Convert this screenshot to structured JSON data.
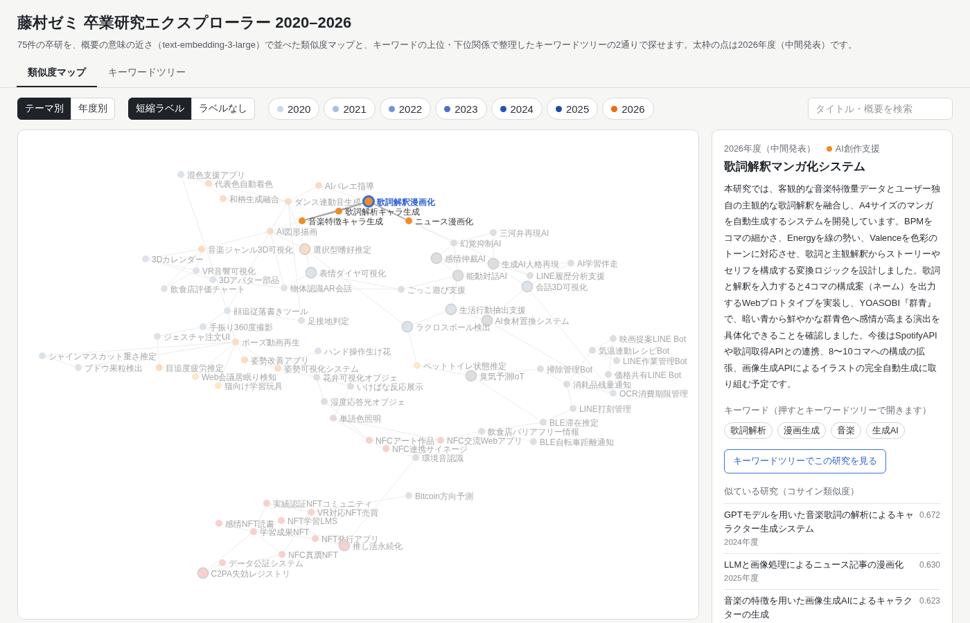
{
  "header": {
    "title": "藤村ゼミ 卒業研究エクスプローラー 2020–2026",
    "description": "75件の卒研を、概要の意味の近さ（text-embedding-3-large）で並べた類似度マップと、キーワードの上位・下位関係で整理したキーワードツリーの2通りで探せます。太枠の点は2026年度（中間発表）です。"
  },
  "tabs": [
    {
      "label": "類似度マップ",
      "selected": true
    },
    {
      "label": "キーワードツリー",
      "selected": false
    }
  ],
  "toolbar": {
    "grouping": [
      {
        "label": "テーマ別",
        "selected": true
      },
      {
        "label": "年度別",
        "selected": false
      }
    ],
    "labels": [
      {
        "label": "短縮ラベル",
        "selected": true
      },
      {
        "label": "ラベルなし",
        "selected": false
      }
    ],
    "years": [
      {
        "label": "2020",
        "color": "#cdd8ee"
      },
      {
        "label": "2021",
        "color": "#a8bce5"
      },
      {
        "label": "2022",
        "color": "#7492dd"
      },
      {
        "label": "2023",
        "color": "#4d6fc6"
      },
      {
        "label": "2024",
        "color": "#2156b2"
      },
      {
        "label": "2025",
        "color": "#1b4c9e"
      },
      {
        "label": "2026",
        "color": "#ec6a12"
      }
    ],
    "search": {
      "placeholder": "タイトル・概要を検索"
    }
  },
  "map": {
    "nodes": [
      {
        "label": "混色支援アプリ",
        "color": "#dde3ea",
        "highlighted": false,
        "selected": false,
        "midterm": false
      },
      {
        "label": "代表色自動着色",
        "color": "#fbdcc2",
        "highlighted": false,
        "selected": false,
        "midterm": false
      },
      {
        "label": "AIバレエ指導",
        "color": "#fbdcc2",
        "highlighted": false,
        "selected": false,
        "midterm": false
      },
      {
        "label": "和柄生成融合",
        "color": "#fbdcc2",
        "highlighted": false,
        "selected": false,
        "midterm": false
      },
      {
        "label": "ダンス連動音生成",
        "color": "#fbdcc2",
        "highlighted": false,
        "selected": false,
        "midterm": false
      },
      {
        "label": "歌詞解釈漫画化",
        "color": "#f28a25",
        "highlighted": true,
        "selected": true,
        "midterm": true
      },
      {
        "label": "歌詞解析キャラ生成",
        "color": "#f28a25",
        "highlighted": true,
        "selected": false,
        "midterm": false
      },
      {
        "label": "音楽特徴キャラ生成",
        "color": "#f28a25",
        "highlighted": true,
        "selected": false,
        "midterm": false
      },
      {
        "label": "ニュース漫画化",
        "color": "#f28a25",
        "highlighted": true,
        "selected": false,
        "midterm": false
      },
      {
        "label": "AI図形描画",
        "color": "#fbdcc2",
        "highlighted": false,
        "selected": false,
        "midterm": false
      },
      {
        "label": "三河弁再現AI",
        "color": "#dedede",
        "highlighted": false,
        "selected": false,
        "midterm": false
      },
      {
        "label": "幻覚抑制AI",
        "color": "#dedede",
        "highlighted": false,
        "selected": false,
        "midterm": false
      },
      {
        "label": "音楽ジャンル3D可視化",
        "color": "#fbdcc2",
        "highlighted": false,
        "selected": false,
        "midterm": false
      },
      {
        "label": "選択型嗜好推定",
        "color": "#fbdcc2",
        "highlighted": false,
        "selected": false,
        "midterm": true
      },
      {
        "label": "3Dカレンダー",
        "color": "#dde3ea",
        "highlighted": false,
        "selected": false,
        "midterm": false
      },
      {
        "label": "感情仲裁AI",
        "color": "#dedede",
        "highlighted": false,
        "selected": false,
        "midterm": true
      },
      {
        "label": "生成AI人格再現",
        "color": "#dedede",
        "highlighted": false,
        "selected": false,
        "midterm": true
      },
      {
        "label": "AI学習伴走",
        "color": "#dedede",
        "highlighted": false,
        "selected": false,
        "midterm": false
      },
      {
        "label": "VR音響可視化",
        "color": "#dde3ea",
        "highlighted": false,
        "selected": false,
        "midterm": false
      },
      {
        "label": "表情ダイヤ可視化",
        "color": "#dde3ea",
        "highlighted": false,
        "selected": false,
        "midterm": true
      },
      {
        "label": "能動対話AI",
        "color": "#dedede",
        "highlighted": false,
        "selected": false,
        "midterm": true
      },
      {
        "label": "LINE履歴分析支援",
        "color": "#dedede",
        "highlighted": false,
        "selected": false,
        "midterm": false
      },
      {
        "label": "3Dアバター部品",
        "color": "#dde3ea",
        "highlighted": false,
        "selected": false,
        "midterm": false
      },
      {
        "label": "飲食店評価チャート",
        "color": "#dde3ea",
        "highlighted": false,
        "selected": false,
        "midterm": false
      },
      {
        "label": "物体認識AR会話",
        "color": "#dde3ea",
        "highlighted": false,
        "selected": false,
        "midterm": false
      },
      {
        "label": "ごっこ遊び支援",
        "color": "#dedede",
        "highlighted": false,
        "selected": false,
        "midterm": false
      },
      {
        "label": "会話3D可視化",
        "color": "#dde3ea",
        "highlighted": false,
        "selected": false,
        "midterm": true
      },
      {
        "label": "顔追従落書きツール",
        "color": "#dde3ea",
        "highlighted": false,
        "selected": false,
        "midterm": false
      },
      {
        "label": "生活行動抽出支援",
        "color": "#dde3ea",
        "highlighted": false,
        "selected": false,
        "midterm": true
      },
      {
        "label": "足接地判定",
        "color": "#dde3ea",
        "highlighted": false,
        "selected": false,
        "midterm": false
      },
      {
        "label": "AI食材置換システム",
        "color": "#dedede",
        "highlighted": false,
        "selected": false,
        "midterm": true
      },
      {
        "label": "手振り360度撮影",
        "color": "#dde3ea",
        "highlighted": false,
        "selected": false,
        "midterm": false
      },
      {
        "label": "ラクロスボール検出",
        "color": "#dde3ea",
        "highlighted": false,
        "selected": false,
        "midterm": true
      },
      {
        "label": "ジェスチャ注文UI",
        "color": "#dde3ea",
        "highlighted": false,
        "selected": false,
        "midterm": false
      },
      {
        "label": "ポーズ動画再生",
        "color": "#fbdcc2",
        "highlighted": false,
        "selected": false,
        "midterm": false
      },
      {
        "label": "映画提案LINE Bot",
        "color": "#dedede",
        "highlighted": false,
        "selected": false,
        "midterm": false
      },
      {
        "label": "シャインマスカット重さ推定",
        "color": "#dde3ea",
        "highlighted": false,
        "selected": false,
        "midterm": false
      },
      {
        "label": "ハンド操作生け花",
        "color": "#dde3ea",
        "highlighted": false,
        "selected": false,
        "midterm": false
      },
      {
        "label": "気温連動レシピBot",
        "color": "#dedede",
        "highlighted": false,
        "selected": false,
        "midterm": false
      },
      {
        "label": "姿勢改善アプリ",
        "color": "#fbdcc2",
        "highlighted": false,
        "selected": false,
        "midterm": false
      },
      {
        "label": "LINE作業管理Bot",
        "color": "#dedede",
        "highlighted": false,
        "selected": false,
        "midterm": false
      },
      {
        "label": "ブドウ果粒検出",
        "color": "#dde3ea",
        "highlighted": false,
        "selected": false,
        "midterm": false
      },
      {
        "label": "目追度疲労推定",
        "color": "#fbdcc2",
        "highlighted": false,
        "selected": false,
        "midterm": false
      },
      {
        "label": "姿勢可視化システム",
        "color": "#fbdcc2",
        "highlighted": false,
        "selected": false,
        "midterm": false
      },
      {
        "label": "ペットトイレ状態推定",
        "color": "#fde8c2",
        "highlighted": false,
        "selected": false,
        "midterm": false
      },
      {
        "label": "掃除管理Bot",
        "color": "#dedede",
        "highlighted": false,
        "selected": false,
        "midterm": false
      },
      {
        "label": "Web会議居眠り検知",
        "color": "#fde8c2",
        "highlighted": false,
        "selected": false,
        "midterm": false
      },
      {
        "label": "花弁可視化オブジェ",
        "color": "#dedede",
        "highlighted": false,
        "selected": false,
        "midterm": false
      },
      {
        "label": "臭気予測IoT",
        "color": "#dedede",
        "highlighted": false,
        "selected": false,
        "midterm": true
      },
      {
        "label": "価格共有LINE Bot",
        "color": "#dedede",
        "highlighted": false,
        "selected": false,
        "midterm": false
      },
      {
        "label": "猫向け学習玩具",
        "color": "#fde8c2",
        "highlighted": false,
        "selected": false,
        "midterm": false
      },
      {
        "label": "いけばな反応展示",
        "color": "#dedede",
        "highlighted": false,
        "selected": false,
        "midterm": false
      },
      {
        "label": "消耗品残量通知",
        "color": "#dedede",
        "highlighted": false,
        "selected": false,
        "midterm": false
      },
      {
        "label": "OCR消費期限管理",
        "color": "#dde3ea",
        "highlighted": false,
        "selected": false,
        "midterm": false
      },
      {
        "label": "湿度応答光オブジェ",
        "color": "#dedede",
        "highlighted": false,
        "selected": false,
        "midterm": false
      },
      {
        "label": "LINE打刻管理",
        "color": "#dedede",
        "highlighted": false,
        "selected": false,
        "midterm": false
      },
      {
        "label": "単語色照明",
        "color": "#e5dada",
        "highlighted": false,
        "selected": false,
        "midterm": false
      },
      {
        "label": "BLE滞在推定",
        "color": "#dedede",
        "highlighted": false,
        "selected": false,
        "midterm": false
      },
      {
        "label": "飲食店バリアフリー情報",
        "color": "#dedede",
        "highlighted": false,
        "selected": false,
        "midterm": false
      },
      {
        "label": "NFCアート作品",
        "color": "#f8d0cc",
        "highlighted": false,
        "selected": false,
        "midterm": false
      },
      {
        "label": "NFC交流Webアプリ",
        "color": "#f8d0cc",
        "highlighted": false,
        "selected": false,
        "midterm": false
      },
      {
        "label": "BLE自転車距離通知",
        "color": "#dedede",
        "highlighted": false,
        "selected": false,
        "midterm": false
      },
      {
        "label": "NFC連携サイネージ",
        "color": "#f8d0cc",
        "highlighted": false,
        "selected": false,
        "midterm": false
      },
      {
        "label": "環境音認識",
        "color": "#dedede",
        "highlighted": false,
        "selected": false,
        "midterm": false
      },
      {
        "label": "Bitcoin方向予測",
        "color": "#dde3ea",
        "highlighted": false,
        "selected": false,
        "midterm": false
      },
      {
        "label": "実績認証NFTコミュニティ",
        "color": "#f8d0cc",
        "highlighted": false,
        "selected": false,
        "midterm": false
      },
      {
        "label": "VR対応NFT売買",
        "color": "#f8d0cc",
        "highlighted": false,
        "selected": false,
        "midterm": false
      },
      {
        "label": "感情NFT読書",
        "color": "#f8d0cc",
        "highlighted": false,
        "selected": false,
        "midterm": false
      },
      {
        "label": "NFT学習LMS",
        "color": "#f8d0cc",
        "highlighted": false,
        "selected": false,
        "midterm": false
      },
      {
        "label": "学習成果NFT",
        "color": "#f8d0cc",
        "highlighted": false,
        "selected": false,
        "midterm": false
      },
      {
        "label": "NFT発行アプリ",
        "color": "#f8d0cc",
        "highlighted": false,
        "selected": false,
        "midterm": false
      },
      {
        "label": "推し活永続化",
        "color": "#f8d0cc",
        "highlighted": false,
        "selected": false,
        "midterm": true
      },
      {
        "label": "NFC真贋NFT",
        "color": "#f8d0cc",
        "highlighted": false,
        "selected": false,
        "midterm": false
      },
      {
        "label": "データ公証システム",
        "color": "#f8d0cc",
        "highlighted": false,
        "selected": false,
        "midterm": false
      },
      {
        "label": "C2PA失効レジストリ",
        "color": "#f8d0cc",
        "highlighted": false,
        "selected": false,
        "midterm": true
      }
    ]
  },
  "detail": {
    "year": "2026年度（中間発表）",
    "theme": {
      "label": "AI創作支援",
      "color": "#f28a25"
    },
    "title": "歌詞解釈マンガ化システム",
    "abstract": "本研究では、客観的な音楽特徴量データとユーザー独自の主観的な歌詞解釈を融合し、A4サイズのマンガを自動生成するシステムを開発しています。BPMをコマの細かさ、Energyを線の勢い、Valenceを色彩のトーンに対応させ、歌詞と主観解釈からストーリーやセリフを構成する変換ロジックを設計しました。歌詞と解釈を入力すると4コマの構成案（ネーム）を出力するWebプロトタイプを実装し、YOASOBI『群青』で、暗い青から鮮やかな群青色へ感情が高まる演出を具体化できることを確認しました。今後はSpotifyAPIや歌詞取得APIとの連携、8〜10コマへの構成の拡張、画像生成APIによるイラストの完全自動生成に取り組む予定です。",
    "keywords_heading": "キーワード（押すとキーワードツリーで開きます）",
    "keywords": [
      "歌詞解析",
      "漫画生成",
      "音楽",
      "生成AI"
    ],
    "tree_button": "キーワードツリーでこの研究を見る",
    "similar_heading": "似ている研究（コサイン類似度）",
    "similar": [
      {
        "title": "GPTモデルを用いた音楽歌詞の解析によるキャラクター生成システム",
        "score": "0.672",
        "year": "2024年度"
      },
      {
        "title": "LLMと画像処理によるニュース記事の漫画化",
        "score": "0.630",
        "year": "2025年度"
      },
      {
        "title": "音楽の特徴を用いた画像生成AIによるキャラクターの生成",
        "score": "0.623"
      }
    ]
  }
}
